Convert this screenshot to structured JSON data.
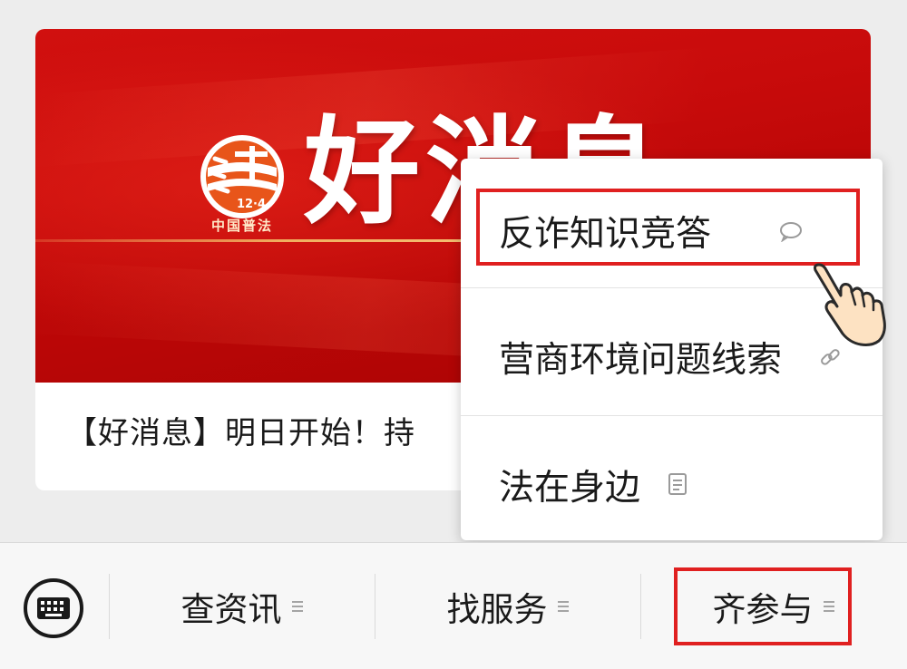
{
  "card": {
    "banner_title": "好消息",
    "logo_text": "12·4",
    "logo_caption": "中国普法",
    "caption": "【好消息】明日开始！持"
  },
  "popup": {
    "items": [
      {
        "label": "反诈知识竞答",
        "icon": "chat-bubble-icon"
      },
      {
        "label": "营商环境问题线索",
        "icon": "link-icon"
      },
      {
        "label": "法在身边",
        "icon": "document-icon"
      }
    ]
  },
  "bottom_menu": {
    "keyboard_icon": "keyboard-icon",
    "tabs": [
      {
        "label": "查资讯"
      },
      {
        "label": "找服务"
      },
      {
        "label": "齐参与"
      }
    ]
  },
  "colors": {
    "banner_red": "#c80b0b",
    "highlight_red": "#e02020",
    "background": "#ededed"
  }
}
